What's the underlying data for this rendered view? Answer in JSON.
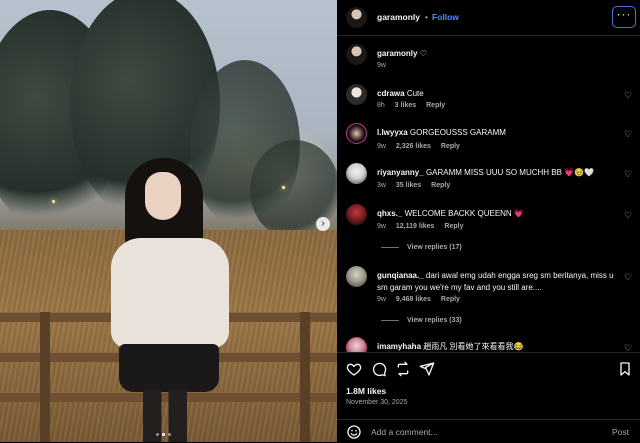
{
  "header": {
    "username": "garamonly",
    "separator": "•",
    "follow_label": "Follow",
    "more_label": "···"
  },
  "caption": {
    "username": "garamonly",
    "text": "♡",
    "time": "9w"
  },
  "comments": [
    {
      "username": "cdrawa",
      "text": "Cute",
      "time": "8h",
      "likes": "3 likes",
      "reply": "Reply"
    },
    {
      "username": "l.lwyyxa",
      "text": "GORGEOUSSS GARAMM",
      "time": "9w",
      "likes": "2,326 likes",
      "reply": "Reply"
    },
    {
      "username": "riyanyanny_",
      "text": "GARAMM MISS UUU SO MUCHH BB 💗🥹🤍",
      "time": "3w",
      "likes": "35 likes",
      "reply": "Reply"
    },
    {
      "username": "qhxs._",
      "text": "WELCOME BACKK QUEENN 💗",
      "time": "9w",
      "likes": "12,119 likes",
      "reply": "Reply",
      "view_replies": "View replies (17)"
    },
    {
      "username": "gunqianaa._",
      "text": "dari awal emg udah engga sreg sm beritanya, miss u sm garam you we're my fav and you still are....",
      "time": "9w",
      "likes": "9,468 likes",
      "reply": "Reply",
      "view_replies": "View replies (33)"
    },
    {
      "username": "imamyhaha",
      "text": "趙雨凡 別看她了來看看我😂"
    }
  ],
  "actions": {
    "likes": "1.8M likes",
    "date": "November 30, 2025",
    "add_comment_placeholder": "Add a comment...",
    "post_label": "Post"
  },
  "carousel": {
    "next_icon": "chevron-right-icon",
    "dots": 3,
    "active_dot": 1
  },
  "colors": {
    "background": "#000000",
    "follow_blue": "#4a8cff",
    "muted_text": "#a8a8a8",
    "divider": "#262626"
  }
}
